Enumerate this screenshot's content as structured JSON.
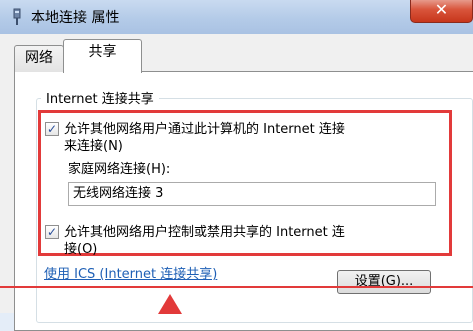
{
  "window": {
    "title": "本地连接 属性",
    "close_glyph": "✕",
    "icon": "network-adapter-icon"
  },
  "tabs": [
    {
      "label": "网络"
    },
    {
      "label": "共享"
    }
  ],
  "group": {
    "title": "Internet 连接共享"
  },
  "options": {
    "allow_connect": {
      "line1": "允许其他网络用户通过此计算机的 Internet 连接",
      "line2": "来连接(N)",
      "checked": true
    },
    "home_network_label": "家庭网络连接(H):",
    "home_network_value": "无线网络连接 3",
    "allow_control": {
      "line1": "允许其他网络用户控制或禁用共享的 Internet 连",
      "line2": "接(O)",
      "checked": true
    }
  },
  "footer": {
    "link": "使用 ICS (Internet 连接共享)",
    "settings_button": "设置(G)..."
  },
  "colors": {
    "highlight": "#e23a3a",
    "link": "#1e5fb5"
  }
}
